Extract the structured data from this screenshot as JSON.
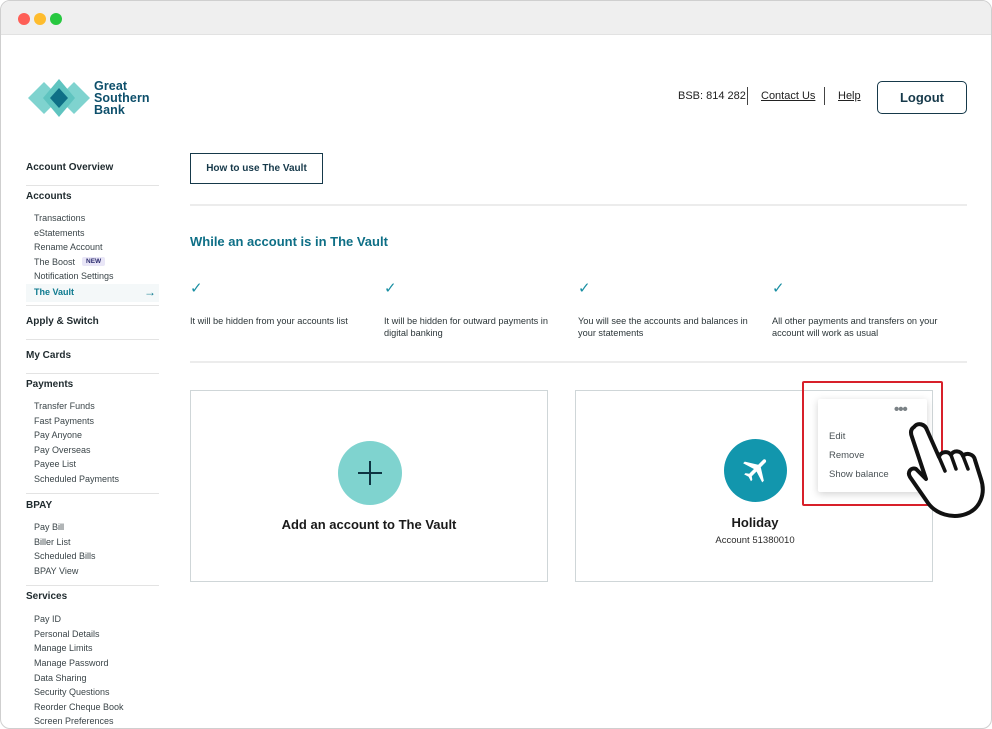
{
  "window": {
    "controls": [
      "close",
      "minimize",
      "maximize"
    ]
  },
  "brand": {
    "line1": "Great",
    "line2": "Southern",
    "line3": "Bank",
    "colors": {
      "teal": "#7fd3cf",
      "navy": "#0d4f6b"
    }
  },
  "header": {
    "bsb": "BSB: 814 282",
    "contact": "Contact Us",
    "help": "Help",
    "logout": "Logout"
  },
  "sidebar": {
    "overview": "Account Overview",
    "accounts": {
      "title": "Accounts",
      "items": [
        "Transactions",
        "eStatements",
        "Rename Account",
        "The Boost",
        "Notification Settings",
        "The Vault"
      ],
      "badge": "NEW"
    },
    "apply": "Apply & Switch",
    "cards": "My Cards",
    "payments": {
      "title": "Payments",
      "items": [
        "Transfer Funds",
        "Fast Payments",
        "Pay Anyone",
        "Pay Overseas",
        "Payee List",
        "Scheduled Payments"
      ]
    },
    "bpay": {
      "title": "BPAY",
      "items": [
        "Pay Bill",
        "Biller List",
        "Scheduled Bills",
        "BPAY View"
      ]
    },
    "services": {
      "title": "Services",
      "items": [
        "Pay ID",
        "Personal Details",
        "Manage Limits",
        "Manage Password",
        "Data Sharing",
        "Security Questions",
        "Reorder Cheque Book",
        "Screen Preferences"
      ]
    }
  },
  "main": {
    "howto": "How to use The Vault",
    "title": "While an account is in The Vault",
    "features": [
      "It will be hidden from your accounts list",
      "It will be hidden for outward payments in digital banking",
      "You will see the accounts and balances in your statements",
      "All other payments and transfers on your account will work as usual"
    ],
    "add_card": {
      "label": "Add an account to The Vault"
    },
    "holiday_card": {
      "name": "Holiday",
      "account": "Account 51380010",
      "icon": "airplane-icon"
    },
    "menu": {
      "items": [
        "Edit",
        "Remove",
        "Show balance"
      ]
    }
  }
}
